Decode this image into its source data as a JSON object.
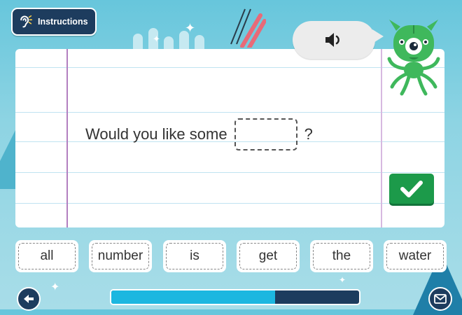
{
  "header": {
    "instructions_label": "Instructions",
    "instructions_icon": "ear-icon"
  },
  "audio": {
    "icon": "speaker-icon"
  },
  "sentence": {
    "before": "Would you like some",
    "blank": "",
    "after": "?"
  },
  "check_button": {
    "icon": "check-icon"
  },
  "word_options": [
    "all",
    "number",
    "is",
    "get",
    "the",
    "water"
  ],
  "footer": {
    "back_icon": "arrow-left-icon",
    "mail_icon": "mail-icon",
    "progress": 0.66
  },
  "colors": {
    "navy": "#1d3c5e",
    "progress_fill": "#1cb7e0",
    "check_green": "#1c9a4a",
    "monster_green": "#3fb85c"
  }
}
